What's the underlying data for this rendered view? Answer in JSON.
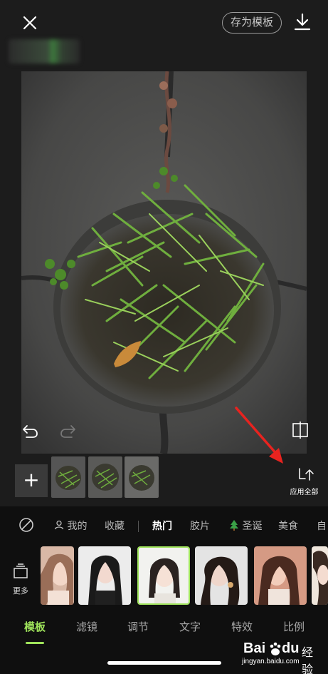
{
  "topbar": {
    "save_template_label": "存为模板"
  },
  "canvas": {
    "apply_all_label": "应用全部"
  },
  "categories": [
    {
      "label": "我的"
    },
    {
      "label": "收藏"
    },
    {
      "label": "热门"
    },
    {
      "label": "胶片"
    },
    {
      "label": "圣诞"
    },
    {
      "label": "美食"
    },
    {
      "label": "自"
    }
  ],
  "templates": {
    "more_label": "更多"
  },
  "bottom_tabs": [
    {
      "label": "模板",
      "active": true
    },
    {
      "label": "滤镜"
    },
    {
      "label": "调节"
    },
    {
      "label": "文字"
    },
    {
      "label": "特效"
    },
    {
      "label": "比例"
    }
  ],
  "watermark": {
    "brand": "Bai",
    "brand2": "du",
    "jy": "经验",
    "url": "jingyan.baidu.com"
  },
  "colors": {
    "accent": "#9fe35b",
    "annotation_arrow": "#e8231f"
  }
}
